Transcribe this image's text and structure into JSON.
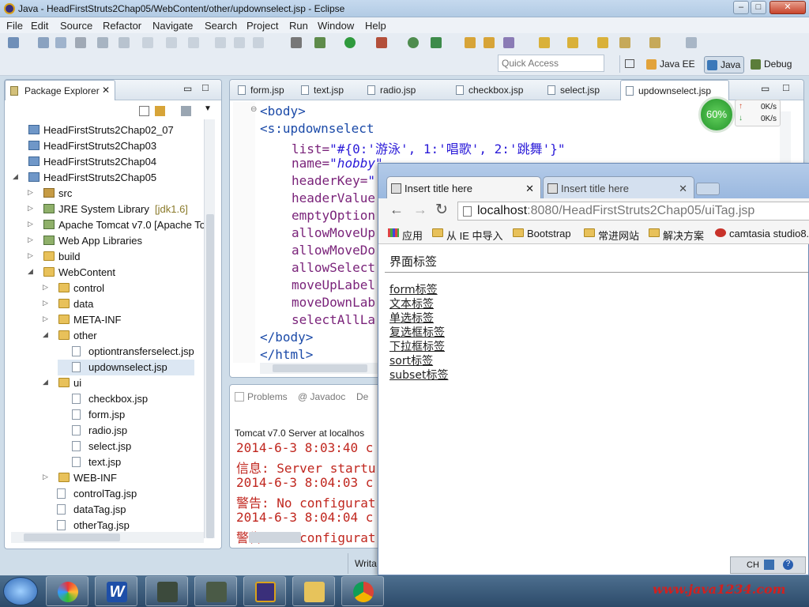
{
  "window": {
    "title": "Java - HeadFirstStruts2Chap05/WebContent/other/updownselect.jsp - Eclipse"
  },
  "menu": [
    "File",
    "Edit",
    "Source",
    "Refactor",
    "Navigate",
    "Search",
    "Project",
    "Run",
    "Window",
    "Help"
  ],
  "quick_access": {
    "placeholder": "Quick Access"
  },
  "perspectives": [
    {
      "label": "Java EE"
    },
    {
      "label": "Java",
      "active": true
    },
    {
      "label": "Debug"
    }
  ],
  "package_explorer": {
    "title": "Package Explorer",
    "items": [
      {
        "label": "HeadFirstStruts2Chap02_07",
        "kind": "project",
        "depth": 0
      },
      {
        "label": "HeadFirstStruts2Chap03",
        "kind": "project",
        "depth": 0
      },
      {
        "label": "HeadFirstStruts2Chap04",
        "kind": "project",
        "depth": 0
      },
      {
        "label": "HeadFirstStruts2Chap05",
        "kind": "project",
        "depth": 0,
        "expanded": true
      },
      {
        "label": "src",
        "kind": "pkg",
        "depth": 1
      },
      {
        "label": "JRE System Library",
        "suffix": "[jdk1.6]",
        "kind": "lib",
        "depth": 1
      },
      {
        "label": "Apache Tomcat v7.0 [Apache To",
        "kind": "lib",
        "depth": 1
      },
      {
        "label": "Web App Libraries",
        "kind": "lib",
        "depth": 1
      },
      {
        "label": "build",
        "kind": "folder",
        "depth": 1
      },
      {
        "label": "WebContent",
        "kind": "folder",
        "depth": 1,
        "expanded": true
      },
      {
        "label": "control",
        "kind": "folder",
        "depth": 2
      },
      {
        "label": "data",
        "kind": "folder",
        "depth": 2
      },
      {
        "label": "META-INF",
        "kind": "folder",
        "depth": 2
      },
      {
        "label": "other",
        "kind": "folder",
        "depth": 2,
        "expanded": true
      },
      {
        "label": "optiontransferselect.jsp",
        "kind": "file",
        "depth": 3
      },
      {
        "label": "updownselect.jsp",
        "kind": "file",
        "depth": 3,
        "selected": true
      },
      {
        "label": "ui",
        "kind": "folder",
        "depth": 2,
        "expanded": true
      },
      {
        "label": "checkbox.jsp",
        "kind": "file",
        "depth": 3
      },
      {
        "label": "form.jsp",
        "kind": "file",
        "depth": 3
      },
      {
        "label": "radio.jsp",
        "kind": "file",
        "depth": 3
      },
      {
        "label": "select.jsp",
        "kind": "file",
        "depth": 3
      },
      {
        "label": "text.jsp",
        "kind": "file",
        "depth": 3
      },
      {
        "label": "WEB-INF",
        "kind": "folder",
        "depth": 2
      },
      {
        "label": "controlTag.jsp",
        "kind": "file",
        "depth": 2
      },
      {
        "label": "dataTag.jsp",
        "kind": "file",
        "depth": 2
      },
      {
        "label": "otherTag.jsp",
        "kind": "file",
        "depth": 2
      }
    ]
  },
  "editor": {
    "tabs": [
      "form.jsp",
      "text.jsp",
      "radio.jsp",
      "checkbox.jsp",
      "select.jsp",
      "updownselect.jsp"
    ],
    "active_tab": "updownselect.jsp",
    "lines": [
      {
        "parts": [
          {
            "c": "tag",
            "t": "<body>"
          }
        ]
      },
      {
        "parts": [
          {
            "c": "tag",
            "t": "<s:updownselect"
          }
        ]
      },
      {
        "parts": [
          {
            "c": "attr",
            "t": "list="
          },
          {
            "c": "str",
            "t": "\"#{0:'游泳', 1:'唱歌', 2:'跳舞'}\""
          }
        ]
      },
      {
        "parts": [
          {
            "c": "attr",
            "t": "name="
          },
          {
            "c": "stri",
            "t": "\"hobby\""
          }
        ]
      },
      {
        "parts": [
          {
            "c": "attr",
            "t": "headerKey="
          },
          {
            "c": "str",
            "t": "\""
          }
        ]
      },
      {
        "parts": [
          {
            "c": "attr",
            "t": "headerValue"
          }
        ]
      },
      {
        "parts": [
          {
            "c": "attr",
            "t": "emptyOption"
          }
        ]
      },
      {
        "parts": [
          {
            "c": "attr",
            "t": "allowMoveUp"
          }
        ]
      },
      {
        "parts": [
          {
            "c": "attr",
            "t": "allowMoveDo"
          }
        ]
      },
      {
        "parts": [
          {
            "c": "attr",
            "t": "allowSelect"
          }
        ]
      },
      {
        "parts": [
          {
            "c": "attr",
            "t": "moveUpLabel"
          }
        ]
      },
      {
        "parts": [
          {
            "c": "attr",
            "t": "moveDownLab"
          }
        ]
      },
      {
        "parts": [
          {
            "c": "attr",
            "t": "selectAllLa"
          }
        ]
      },
      {
        "parts": [
          {
            "c": "tag",
            "t": "</body>"
          }
        ]
      },
      {
        "parts": [
          {
            "c": "tag",
            "t": "</html>"
          }
        ]
      }
    ]
  },
  "speed_widget": {
    "percent": "60%",
    "up": "0K/s",
    "down": "0K/s"
  },
  "bottom_panel": {
    "tabs": [
      "Problems",
      "@ Javadoc",
      "De"
    ],
    "server_line": "Tomcat v7.0 Server at localhos",
    "console": [
      "2014-6-3 8:03:40 c",
      "信息: Server startu",
      "2014-6-3 8:04:03 c",
      "警告: No configurat",
      "2014-6-3 8:04:04 c",
      "警告: No configurat"
    ],
    "status_fragment": "Writa"
  },
  "browser": {
    "tabs": [
      {
        "title": "Insert title here",
        "active": true
      },
      {
        "title": "Insert title here",
        "active": false
      }
    ],
    "url_host": "localhost",
    "url_rest": ":8080/HeadFirstStruts2Chap05/uiTag.jsp",
    "bookmarks": [
      "应用",
      "从 IE 中导入",
      "Bootstrap",
      "常进网站",
      "解决方案",
      "camtasia studio8."
    ],
    "page": {
      "heading": "界面标签",
      "links": [
        "form标签",
        "文本标签",
        "单选标签",
        "复选框标签",
        "下拉框标签",
        "sort标签",
        "subset标签"
      ]
    }
  },
  "tray": {
    "ime": "CH"
  },
  "watermark": "www.java1234.com"
}
